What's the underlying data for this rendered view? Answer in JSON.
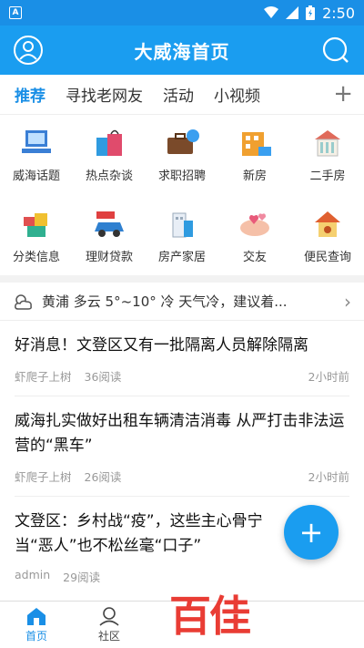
{
  "status": {
    "time": "2:50",
    "left_icon": "A"
  },
  "header": {
    "title": "大威海首页"
  },
  "tabs": [
    {
      "label": "推荐"
    },
    {
      "label": "寻找老网友"
    },
    {
      "label": "活动"
    },
    {
      "label": "小视频"
    }
  ],
  "tab_add": "+",
  "grid": [
    {
      "label": "威海话题",
      "icon": "topic-icon"
    },
    {
      "label": "热点杂谈",
      "icon": "shopping-bags-icon"
    },
    {
      "label": "求职招聘",
      "icon": "briefcase-icon"
    },
    {
      "label": "新房",
      "icon": "new-house-icon"
    },
    {
      "label": "二手房",
      "icon": "second-house-icon"
    },
    {
      "label": "分类信息",
      "icon": "category-icon"
    },
    {
      "label": "理财贷款",
      "icon": "car-sale-icon"
    },
    {
      "label": "房产家居",
      "icon": "building-icon"
    },
    {
      "label": "交友",
      "icon": "love-icon"
    },
    {
      "label": "便民查询",
      "icon": "house-search-icon"
    }
  ],
  "weather": {
    "text": "黄浦 多云 5°~10° 冷 天气冷，建议着..."
  },
  "news": [
    {
      "title": "好消息！文登区又有一批隔离人员解除隔离",
      "author": "虾爬子上树",
      "reads": "36阅读",
      "time": "2小时前"
    },
    {
      "title": "威海扎实做好出租车辆清洁消毒 从严打击非法运营的“黑车”",
      "author": "虾爬子上树",
      "reads": "26阅读",
      "time": "2小时前"
    },
    {
      "title": "文登区：乡村战“疫”，这些主心骨宁当“恶人”也不松丝毫“口子”",
      "author": "admin",
      "reads": "29阅读",
      "time": ""
    }
  ],
  "fab": "+",
  "bottom_nav": [
    {
      "label": "首页"
    },
    {
      "label": "社区"
    },
    {
      "label": ""
    },
    {
      "label": ""
    },
    {
      "label": ""
    }
  ],
  "watermark": "百佳",
  "colors": {
    "accent": "#1a9df0",
    "watermark": "#e8322a"
  }
}
